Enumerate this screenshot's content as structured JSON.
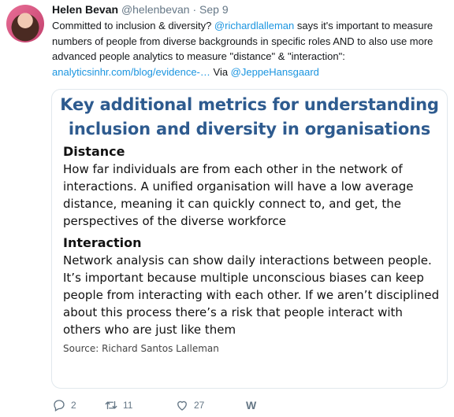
{
  "tweet": {
    "author_name": "Helen Bevan",
    "author_handle": "@helenbevan",
    "separator": "·",
    "date": "Sep 9",
    "text_before_mention": "Committed to inclusion & diversity? ",
    "mention": "@richardlalleman",
    "text_after_mention": " says it's important to measure numbers of people from diverse backgrounds in specific roles AND to also use more advanced people analytics to measure \"distance\" & \"interaction\": ",
    "url": "analyticsinhr.com/blog/evidence-…",
    "via_label": " Via  ",
    "via_mention": "@JeppeHansgaard"
  },
  "card": {
    "title_line1": "Key additional metrics for understanding",
    "title_line2": "inclusion and diversity in organisations",
    "sections": [
      {
        "heading": "Distance",
        "text": "How far individuals are from each other in the network of interactions. A unified organisation will have a low average distance, meaning it can quickly connect to, and get, the perspectives of the diverse workforce"
      },
      {
        "heading": "Interaction",
        "text": "Network analysis can show daily interactions between people.  It’s important because multiple  unconscious biases can keep people from interacting with each other. If we aren’t disciplined about this process there’s a risk that people interact with others who are just like them"
      }
    ],
    "source": "Source: Richard Santos Lalleman"
  },
  "actions": {
    "reply_count": "2",
    "retweet_count": "11",
    "like_count": "27",
    "extra_icon": "W"
  },
  "icons": [
    "reply-icon",
    "retweet-icon",
    "like-icon",
    "w-icon"
  ],
  "colors": {
    "link": "#1b95e0",
    "card_title": "#2e5b8f",
    "muted": "#657786"
  }
}
